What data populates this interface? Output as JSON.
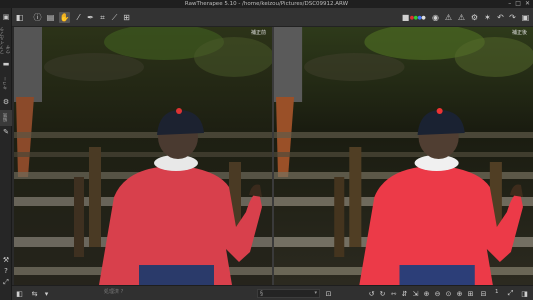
{
  "window": {
    "title": "RawTherapee 5.10 - /home/keizou/Pictures/DSC09912.ARW",
    "controls": [
      "–",
      "□",
      "✕"
    ]
  },
  "toolbar": {
    "left_icons": [
      "pane-toggle-icon",
      "info-icon",
      "history-icon",
      "hand-icon",
      "white-balance-picker-icon",
      "color-picker-icon",
      "crop-icon",
      "straighten-icon",
      "queue-icon"
    ],
    "right_icons": [
      "color-label-icon",
      "preview-r-icon",
      "preview-g-icon",
      "preview-b-icon",
      "preview-l-icon",
      "focus-mask-icon",
      "clipped-shadows-icon",
      "clipped-highlights-icon",
      "gear-icon",
      "favorite-icon",
      "undo-icon",
      "redo-icon",
      "snapshot-icon"
    ]
  },
  "left_panel": {
    "tabs": [
      "ファイルブラウザ",
      "キュー",
      "編集"
    ]
  },
  "panels": {
    "left_label": "補正前",
    "right_label": "補正後"
  },
  "bottom_bar": {
    "left_text": "処理済 ?",
    "profile_value": "",
    "zoom_value": "1"
  }
}
